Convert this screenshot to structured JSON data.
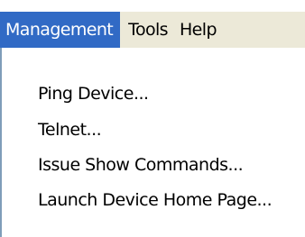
{
  "menubar": {
    "items": [
      {
        "label": "Management",
        "active": true
      },
      {
        "label": "Tools",
        "active": false
      },
      {
        "label": "Help",
        "active": false
      }
    ]
  },
  "dropdown": {
    "items": [
      {
        "label": "Ping Device..."
      },
      {
        "label": "Telnet..."
      },
      {
        "label": "Issue Show Commands..."
      },
      {
        "label": "Launch Device Home Page..."
      }
    ]
  },
  "colors": {
    "menubar_background": "#ece9d8",
    "active_highlight": "#316ac5",
    "active_text": "#ffffff",
    "text": "#000000",
    "menu_background": "#ffffff"
  }
}
